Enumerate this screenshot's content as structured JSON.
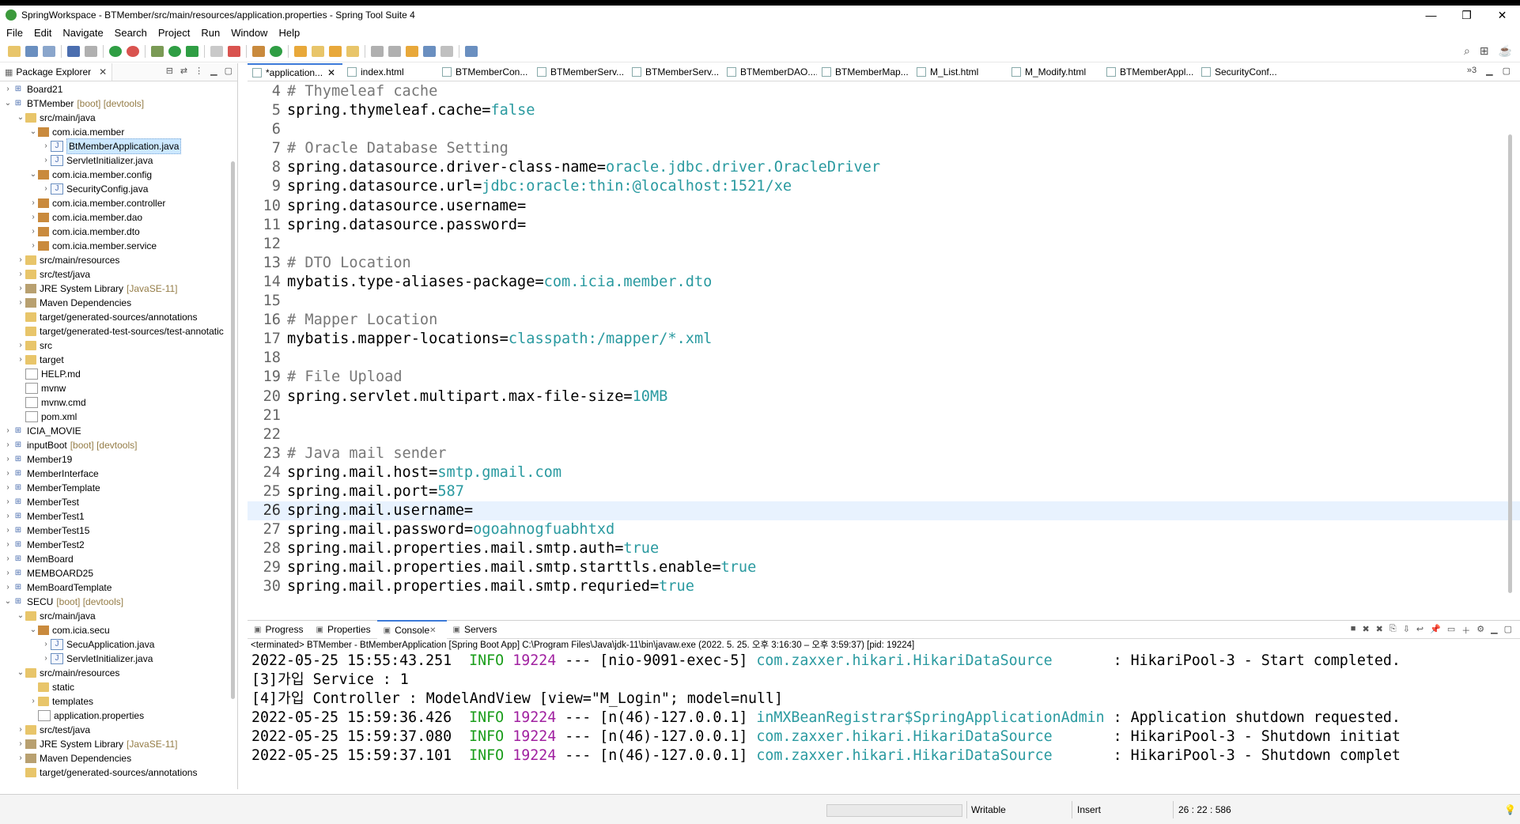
{
  "window": {
    "title": "SpringWorkspace - BTMember/src/main/resources/application.properties - Spring Tool Suite 4",
    "controls": [
      "—",
      "❐",
      "✕"
    ]
  },
  "menu": [
    "File",
    "Edit",
    "Navigate",
    "Search",
    "Project",
    "Run",
    "Window",
    "Help"
  ],
  "left_panel": {
    "tab_label": "Package Explorer",
    "tree": [
      {
        "label": "Board21",
        "depth": 0,
        "arrow": "›",
        "icon": "project-icon"
      },
      {
        "label": "BTMember",
        "deco": "[boot] [devtools]",
        "depth": 0,
        "arrow": "⌄",
        "icon": "project-icon"
      },
      {
        "label": "src/main/java",
        "depth": 1,
        "arrow": "⌄",
        "icon": "source-folder-icon"
      },
      {
        "label": "com.icia.member",
        "depth": 2,
        "arrow": "⌄",
        "icon": "package-icon"
      },
      {
        "label": "BtMemberApplication.java",
        "depth": 3,
        "arrow": "›",
        "icon": "java-file-icon",
        "selected": true
      },
      {
        "label": "ServletInitializer.java",
        "depth": 3,
        "arrow": "›",
        "icon": "java-file-icon"
      },
      {
        "label": "com.icia.member.config",
        "depth": 2,
        "arrow": "⌄",
        "icon": "package-icon"
      },
      {
        "label": "SecurityConfig.java",
        "depth": 3,
        "arrow": "›",
        "icon": "java-file-icon"
      },
      {
        "label": "com.icia.member.controller",
        "depth": 2,
        "arrow": "›",
        "icon": "package-icon"
      },
      {
        "label": "com.icia.member.dao",
        "depth": 2,
        "arrow": "›",
        "icon": "package-icon"
      },
      {
        "label": "com.icia.member.dto",
        "depth": 2,
        "arrow": "›",
        "icon": "package-icon"
      },
      {
        "label": "com.icia.member.service",
        "depth": 2,
        "arrow": "›",
        "icon": "package-icon"
      },
      {
        "label": "src/main/resources",
        "depth": 1,
        "arrow": "›",
        "icon": "source-folder-icon"
      },
      {
        "label": "src/test/java",
        "depth": 1,
        "arrow": "›",
        "icon": "source-folder-icon"
      },
      {
        "label": "JRE System Library",
        "deco": "[JavaSE-11]",
        "depth": 1,
        "arrow": "›",
        "icon": "library-icon"
      },
      {
        "label": "Maven Dependencies",
        "depth": 1,
        "arrow": "›",
        "icon": "library-icon"
      },
      {
        "label": "target/generated-sources/annotations",
        "depth": 1,
        "arrow": "",
        "icon": "source-folder-icon"
      },
      {
        "label": "target/generated-test-sources/test-annotatic",
        "depth": 1,
        "arrow": "",
        "icon": "source-folder-icon"
      },
      {
        "label": "src",
        "depth": 1,
        "arrow": "›",
        "icon": "folder-icon"
      },
      {
        "label": "target",
        "depth": 1,
        "arrow": "›",
        "icon": "folder-icon"
      },
      {
        "label": "HELP.md",
        "depth": 1,
        "arrow": "",
        "icon": "file-icon"
      },
      {
        "label": "mvnw",
        "depth": 1,
        "arrow": "",
        "icon": "file-icon"
      },
      {
        "label": "mvnw.cmd",
        "depth": 1,
        "arrow": "",
        "icon": "file-icon"
      },
      {
        "label": "pom.xml",
        "depth": 1,
        "arrow": "",
        "icon": "file-icon"
      },
      {
        "label": "ICIA_MOVIE",
        "depth": 0,
        "arrow": "›",
        "icon": "project-icon"
      },
      {
        "label": "inputBoot",
        "deco": "[boot] [devtools]",
        "depth": 0,
        "arrow": "›",
        "icon": "project-icon"
      },
      {
        "label": "Member19",
        "depth": 0,
        "arrow": "›",
        "icon": "project-icon"
      },
      {
        "label": "MemberInterface",
        "depth": 0,
        "arrow": "›",
        "icon": "project-icon"
      },
      {
        "label": "MemberTemplate",
        "depth": 0,
        "arrow": "›",
        "icon": "project-icon"
      },
      {
        "label": "MemberTest",
        "depth": 0,
        "arrow": "›",
        "icon": "project-icon"
      },
      {
        "label": "MemberTest1",
        "depth": 0,
        "arrow": "›",
        "icon": "project-icon"
      },
      {
        "label": "MemberTest15",
        "depth": 0,
        "arrow": "›",
        "icon": "project-icon"
      },
      {
        "label": "MemberTest2",
        "depth": 0,
        "arrow": "›",
        "icon": "project-icon"
      },
      {
        "label": "MemBoard",
        "depth": 0,
        "arrow": "›",
        "icon": "project-icon"
      },
      {
        "label": "MEMBOARD25",
        "depth": 0,
        "arrow": "›",
        "icon": "project-icon"
      },
      {
        "label": "MemBoardTemplate",
        "depth": 0,
        "arrow": "›",
        "icon": "project-icon"
      },
      {
        "label": "SECU",
        "deco": "[boot] [devtools]",
        "depth": 0,
        "arrow": "⌄",
        "icon": "project-icon"
      },
      {
        "label": "src/main/java",
        "depth": 1,
        "arrow": "⌄",
        "icon": "source-folder-icon"
      },
      {
        "label": "com.icia.secu",
        "depth": 2,
        "arrow": "⌄",
        "icon": "package-icon"
      },
      {
        "label": "SecuApplication.java",
        "depth": 3,
        "arrow": "›",
        "icon": "java-file-icon"
      },
      {
        "label": "ServletInitializer.java",
        "depth": 3,
        "arrow": "›",
        "icon": "java-file-icon"
      },
      {
        "label": "src/main/resources",
        "depth": 1,
        "arrow": "⌄",
        "icon": "source-folder-icon"
      },
      {
        "label": "static",
        "depth": 2,
        "arrow": "",
        "icon": "folder-icon"
      },
      {
        "label": "templates",
        "depth": 2,
        "arrow": "›",
        "icon": "folder-icon"
      },
      {
        "label": "application.properties",
        "depth": 2,
        "arrow": "",
        "icon": "properties-file-icon"
      },
      {
        "label": "src/test/java",
        "depth": 1,
        "arrow": "›",
        "icon": "source-folder-icon"
      },
      {
        "label": "JRE System Library",
        "deco": "[JavaSE-11]",
        "depth": 1,
        "arrow": "›",
        "icon": "library-icon"
      },
      {
        "label": "Maven Dependencies",
        "depth": 1,
        "arrow": "›",
        "icon": "library-icon"
      },
      {
        "label": "target/generated-sources/annotations",
        "depth": 1,
        "arrow": "",
        "icon": "source-folder-icon"
      },
      {
        "label": "target/generated-test-sources/test-annotatic",
        "depth": 1,
        "arrow": "",
        "icon": "source-folder-icon"
      }
    ]
  },
  "editor": {
    "tabs": [
      {
        "label": "*application...",
        "active": true,
        "close": "✕"
      },
      {
        "label": "index.html"
      },
      {
        "label": "BTMemberCon..."
      },
      {
        "label": "BTMemberServ..."
      },
      {
        "label": "BTMemberServ..."
      },
      {
        "label": "BTMemberDAO...."
      },
      {
        "label": "BTMemberMap..."
      },
      {
        "label": "M_List.html"
      },
      {
        "label": "M_Modify.html"
      },
      {
        "label": "BTMemberAppl..."
      },
      {
        "label": "SecurityConf..."
      }
    ],
    "overflow": "»3",
    "lines": [
      {
        "n": "4",
        "parts": [
          {
            "t": "# Thymeleaf cache",
            "c": "cmt"
          }
        ]
      },
      {
        "n": "5",
        "parts": [
          {
            "t": "spring.thymeleaf.cache=",
            "c": "key"
          },
          {
            "t": "false",
            "c": "val"
          }
        ]
      },
      {
        "n": "6",
        "parts": []
      },
      {
        "n": "7",
        "parts": [
          {
            "t": "# Oracle Database Setting",
            "c": "cmt"
          }
        ]
      },
      {
        "n": "8",
        "parts": [
          {
            "t": "spring.datasource.driver-class-name=",
            "c": "key"
          },
          {
            "t": "oracle.jdbc.driver.OracleDriver",
            "c": "val"
          }
        ]
      },
      {
        "n": "9",
        "parts": [
          {
            "t": "spring.datasource.url=",
            "c": "key"
          },
          {
            "t": "jdbc:oracle:thin:@localhost:1521/xe",
            "c": "val"
          }
        ]
      },
      {
        "n": "10",
        "parts": [
          {
            "t": "spring.datasource.username=",
            "c": "key"
          }
        ]
      },
      {
        "n": "11",
        "parts": [
          {
            "t": "spring.datasource.password=",
            "c": "key"
          }
        ]
      },
      {
        "n": "12",
        "parts": []
      },
      {
        "n": "13",
        "parts": [
          {
            "t": "# DTO Location",
            "c": "cmt"
          }
        ]
      },
      {
        "n": "14",
        "parts": [
          {
            "t": "mybatis.type-aliases-package=",
            "c": "key"
          },
          {
            "t": "com.icia.member.dto",
            "c": "val"
          }
        ]
      },
      {
        "n": "15",
        "parts": []
      },
      {
        "n": "16",
        "parts": [
          {
            "t": "# Mapper Location",
            "c": "cmt"
          }
        ]
      },
      {
        "n": "17",
        "parts": [
          {
            "t": "mybatis.mapper-locations=",
            "c": "key"
          },
          {
            "t": "classpath:/mapper/*.xml",
            "c": "val"
          }
        ]
      },
      {
        "n": "18",
        "parts": []
      },
      {
        "n": "19",
        "parts": [
          {
            "t": "# File Upload",
            "c": "cmt"
          }
        ]
      },
      {
        "n": "20",
        "parts": [
          {
            "t": "spring.servlet.multipart.max-file-size=",
            "c": "key"
          },
          {
            "t": "10MB",
            "c": "val"
          }
        ]
      },
      {
        "n": "21",
        "parts": []
      },
      {
        "n": "22",
        "parts": []
      },
      {
        "n": "23",
        "parts": [
          {
            "t": "# Java mail sender",
            "c": "cmt"
          }
        ]
      },
      {
        "n": "24",
        "parts": [
          {
            "t": "spring.mail.host=",
            "c": "key"
          },
          {
            "t": "smtp.gmail.com",
            "c": "val"
          }
        ]
      },
      {
        "n": "25",
        "parts": [
          {
            "t": "spring.mail.port=",
            "c": "key"
          },
          {
            "t": "587",
            "c": "val"
          }
        ]
      },
      {
        "n": "26",
        "parts": [
          {
            "t": "spring.mail.username=",
            "c": "key"
          }
        ],
        "current": true
      },
      {
        "n": "27",
        "parts": [
          {
            "t": "spring.mail.password=",
            "c": "key"
          },
          {
            "t": "ogoahnogfuabhtxd",
            "c": "val"
          }
        ]
      },
      {
        "n": "28",
        "parts": [
          {
            "t": "spring.mail.properties.mail.smtp.auth=",
            "c": "key"
          },
          {
            "t": "true",
            "c": "val"
          }
        ]
      },
      {
        "n": "29",
        "parts": [
          {
            "t": "spring.mail.properties.mail.smtp.starttls.enable=",
            "c": "key"
          },
          {
            "t": "true",
            "c": "val"
          }
        ]
      },
      {
        "n": "30",
        "parts": [
          {
            "t": "spring.mail.properties.mail.smtp.requried=",
            "c": "key"
          },
          {
            "t": "true",
            "c": "val"
          }
        ]
      }
    ]
  },
  "console": {
    "tabs": [
      {
        "label": "Progress"
      },
      {
        "label": "Properties"
      },
      {
        "label": "Console",
        "active": true,
        "close": "✕"
      },
      {
        "label": "Servers"
      }
    ],
    "status": "<terminated> BTMember - BtMemberApplication [Spring Boot App] C:\\Program Files\\Java\\jdk-11\\bin\\javaw.exe  (2022. 5. 25. 오후 3:16:30 – 오후 3:59:37) [pid: 19224]",
    "lines": [
      [
        {
          "t": "2022-05-25 15:55:43.251  ",
          "c": "plain"
        },
        {
          "t": "INFO",
          "c": "info"
        },
        {
          "t": " ",
          "c": "plain"
        },
        {
          "t": "19224",
          "c": "pid"
        },
        {
          "t": " --- [nio-9091-exec-5] ",
          "c": "plain"
        },
        {
          "t": "com.zaxxer.hikari.HikariDataSource      ",
          "c": "cls"
        },
        {
          "t": " : HikariPool-3 - Start completed.",
          "c": "plain"
        }
      ],
      [
        {
          "t": "[3]가입 Service : 1",
          "c": "plain"
        }
      ],
      [
        {
          "t": "[4]가입 Controller : ModelAndView [view=\"M_Login\"; model=null]",
          "c": "plain"
        }
      ],
      [
        {
          "t": "2022-05-25 15:59:36.426  ",
          "c": "plain"
        },
        {
          "t": "INFO",
          "c": "info"
        },
        {
          "t": " ",
          "c": "plain"
        },
        {
          "t": "19224",
          "c": "pid"
        },
        {
          "t": " --- [n(46)-127.0.0.1] ",
          "c": "plain"
        },
        {
          "t": "inMXBeanRegistrar$SpringApplicationAdmin",
          "c": "cls"
        },
        {
          "t": " : Application shutdown requested.",
          "c": "plain"
        }
      ],
      [
        {
          "t": "2022-05-25 15:59:37.080  ",
          "c": "plain"
        },
        {
          "t": "INFO",
          "c": "info"
        },
        {
          "t": " ",
          "c": "plain"
        },
        {
          "t": "19224",
          "c": "pid"
        },
        {
          "t": " --- [n(46)-127.0.0.1] ",
          "c": "plain"
        },
        {
          "t": "com.zaxxer.hikari.HikariDataSource      ",
          "c": "cls"
        },
        {
          "t": " : HikariPool-3 - Shutdown initiat",
          "c": "plain"
        }
      ],
      [
        {
          "t": "2022-05-25 15:59:37.101  ",
          "c": "plain"
        },
        {
          "t": "INFO",
          "c": "info"
        },
        {
          "t": " ",
          "c": "plain"
        },
        {
          "t": "19224",
          "c": "pid"
        },
        {
          "t": " --- [n(46)-127.0.0.1] ",
          "c": "plain"
        },
        {
          "t": "com.zaxxer.hikari.HikariDataSource      ",
          "c": "cls"
        },
        {
          "t": " : HikariPool-3 - Shutdown complet",
          "c": "plain"
        }
      ]
    ]
  },
  "statusbar": {
    "writable": "Writable",
    "insert": "Insert",
    "position": "26 : 22 : 586"
  },
  "colors": {
    "comment": "#777777",
    "value": "#2a9aa0",
    "info": "#1a9d1a",
    "pid": "#a020a0",
    "current_line": "#e8f2fe",
    "selection": "#cce8ff"
  }
}
